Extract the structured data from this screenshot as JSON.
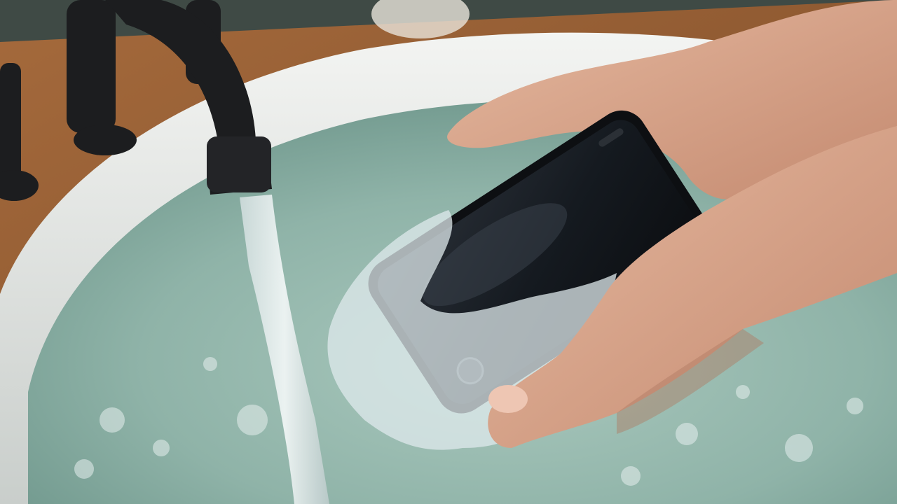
{
  "scene": {
    "description_colors": {
      "wall": "#3f4a45",
      "countertop": "#9a6236",
      "countertop_dark": "#6b3f20",
      "tub_rim": "#e9ebe8",
      "tub_shadow": "#b9bfbc",
      "water": "#8fb3a8",
      "water_deep": "#6f978c",
      "faucet": "#1c1d1f",
      "skin": "#d9a98f",
      "skin_shadow": "#b07a62",
      "phone_body": "#0d0f12",
      "phone_screen": "#1c2128",
      "splash": "#dfe9ec"
    },
    "objects": [
      "faucet",
      "water-stream",
      "bathtub",
      "tub-water",
      "phone",
      "left-hand",
      "right-hand",
      "water-splash",
      "faucet-handles",
      "countertop"
    ]
  }
}
